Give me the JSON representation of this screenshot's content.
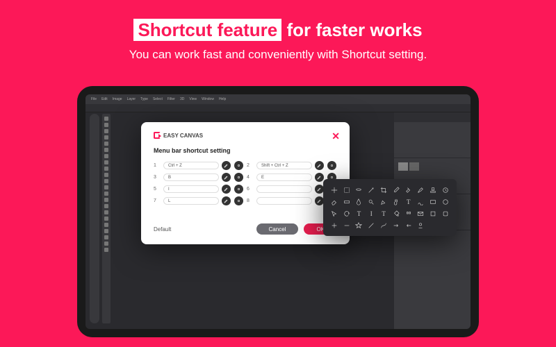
{
  "hero": {
    "highlight": "Shortcut feature",
    "rest": " for faster works",
    "subtitle": "You can work fast and conveniently with Shortcut setting."
  },
  "app": {
    "menus": [
      "File",
      "Edit",
      "Image",
      "Layer",
      "Type",
      "Select",
      "Filter",
      "3D",
      "View",
      "Window",
      "Help"
    ]
  },
  "modal": {
    "brand": "EASY CANVAS",
    "title": "Menu bar shortcut setting",
    "rows": [
      {
        "n": "1",
        "val": "Ctrl + Z"
      },
      {
        "n": "2",
        "val": "Shift + Ctrl + Z"
      },
      {
        "n": "3",
        "val": "B"
      },
      {
        "n": "4",
        "val": "E"
      },
      {
        "n": "5",
        "val": "I"
      },
      {
        "n": "6",
        "val": ""
      },
      {
        "n": "7",
        "val": "L"
      },
      {
        "n": "8",
        "val": ""
      }
    ],
    "default": "Default",
    "cancel": "Cancel",
    "ok": "OK"
  },
  "picker": {
    "icons": [
      "move",
      "marquee",
      "lasso",
      "wand",
      "crop",
      "eyedrop",
      "heal",
      "brush",
      "stamp",
      "history",
      "eraser",
      "gradient",
      "blur",
      "dodge",
      "pen",
      "hand",
      "text",
      "path",
      "rect",
      "circle",
      "cursor",
      "rotate",
      "typeT",
      "textI",
      "serifT",
      "bucket",
      "quote",
      "envelope",
      "square",
      "square2",
      "plus",
      "minus",
      "star",
      "line",
      "curve",
      "arrow",
      "rarrow",
      "stamp2",
      "blank",
      "blank"
    ]
  }
}
